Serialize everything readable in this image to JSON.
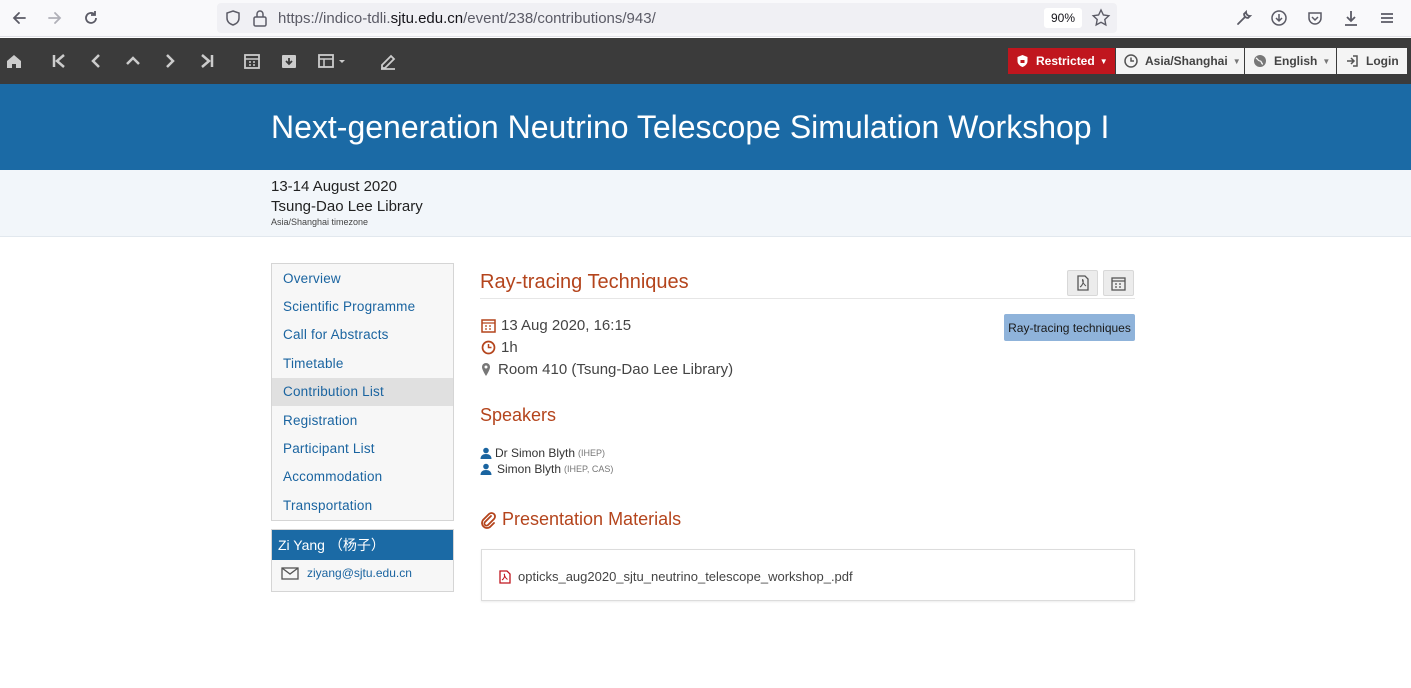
{
  "browser": {
    "url_prefix": "https://indico-tdli.",
    "url_host": "sjtu.edu.cn",
    "url_path": "/event/238/contributions/943/",
    "zoom": "90%"
  },
  "toolbar": {
    "restricted_label": "Restricted",
    "timezone_label": "Asia/Shanghai",
    "language_label": "English",
    "login_label": "Login"
  },
  "event": {
    "title": "Next-generation Neutrino Telescope Simulation Workshop I",
    "date": "13-14 August 2020",
    "venue": "Tsung-Dao Lee Library",
    "timezone_note": "Asia/Shanghai timezone"
  },
  "sidebar": {
    "items": [
      {
        "label": "Overview"
      },
      {
        "label": "Scientific Programme"
      },
      {
        "label": "Call for Abstracts"
      },
      {
        "label": "Timetable"
      },
      {
        "label": "Contribution List"
      },
      {
        "label": "Registration"
      },
      {
        "label": "Participant List"
      },
      {
        "label": "Accommodation"
      },
      {
        "label": "Transportation"
      }
    ],
    "active_index": 4,
    "contact": {
      "name": "Zi Yang （杨子）",
      "email": "ziyang@sjtu.edu.cn"
    }
  },
  "contribution": {
    "title": "Ray-tracing Techniques",
    "track": "Ray-tracing techniques",
    "datetime": "13 Aug 2020, 16:15",
    "duration": "1h",
    "room": "Room 410 (Tsung-Dao Lee Library)",
    "speakers_heading": "Speakers",
    "speakers": [
      {
        "name": "Dr Simon Blyth",
        "affiliation": "(IHEP)"
      },
      {
        "name": "Simon Blyth",
        "affiliation": "(IHEP, CAS)"
      }
    ],
    "materials_heading": "Presentation Materials",
    "material_file": "opticks_aug2020_sjtu_neutrino_telescope_workshop_.pdf"
  },
  "colors": {
    "header_blue": "#1b6aa5",
    "accent_orange": "#b4441c",
    "restricted_red": "#c0161e",
    "toolbar_dark": "#3b3b3b"
  }
}
